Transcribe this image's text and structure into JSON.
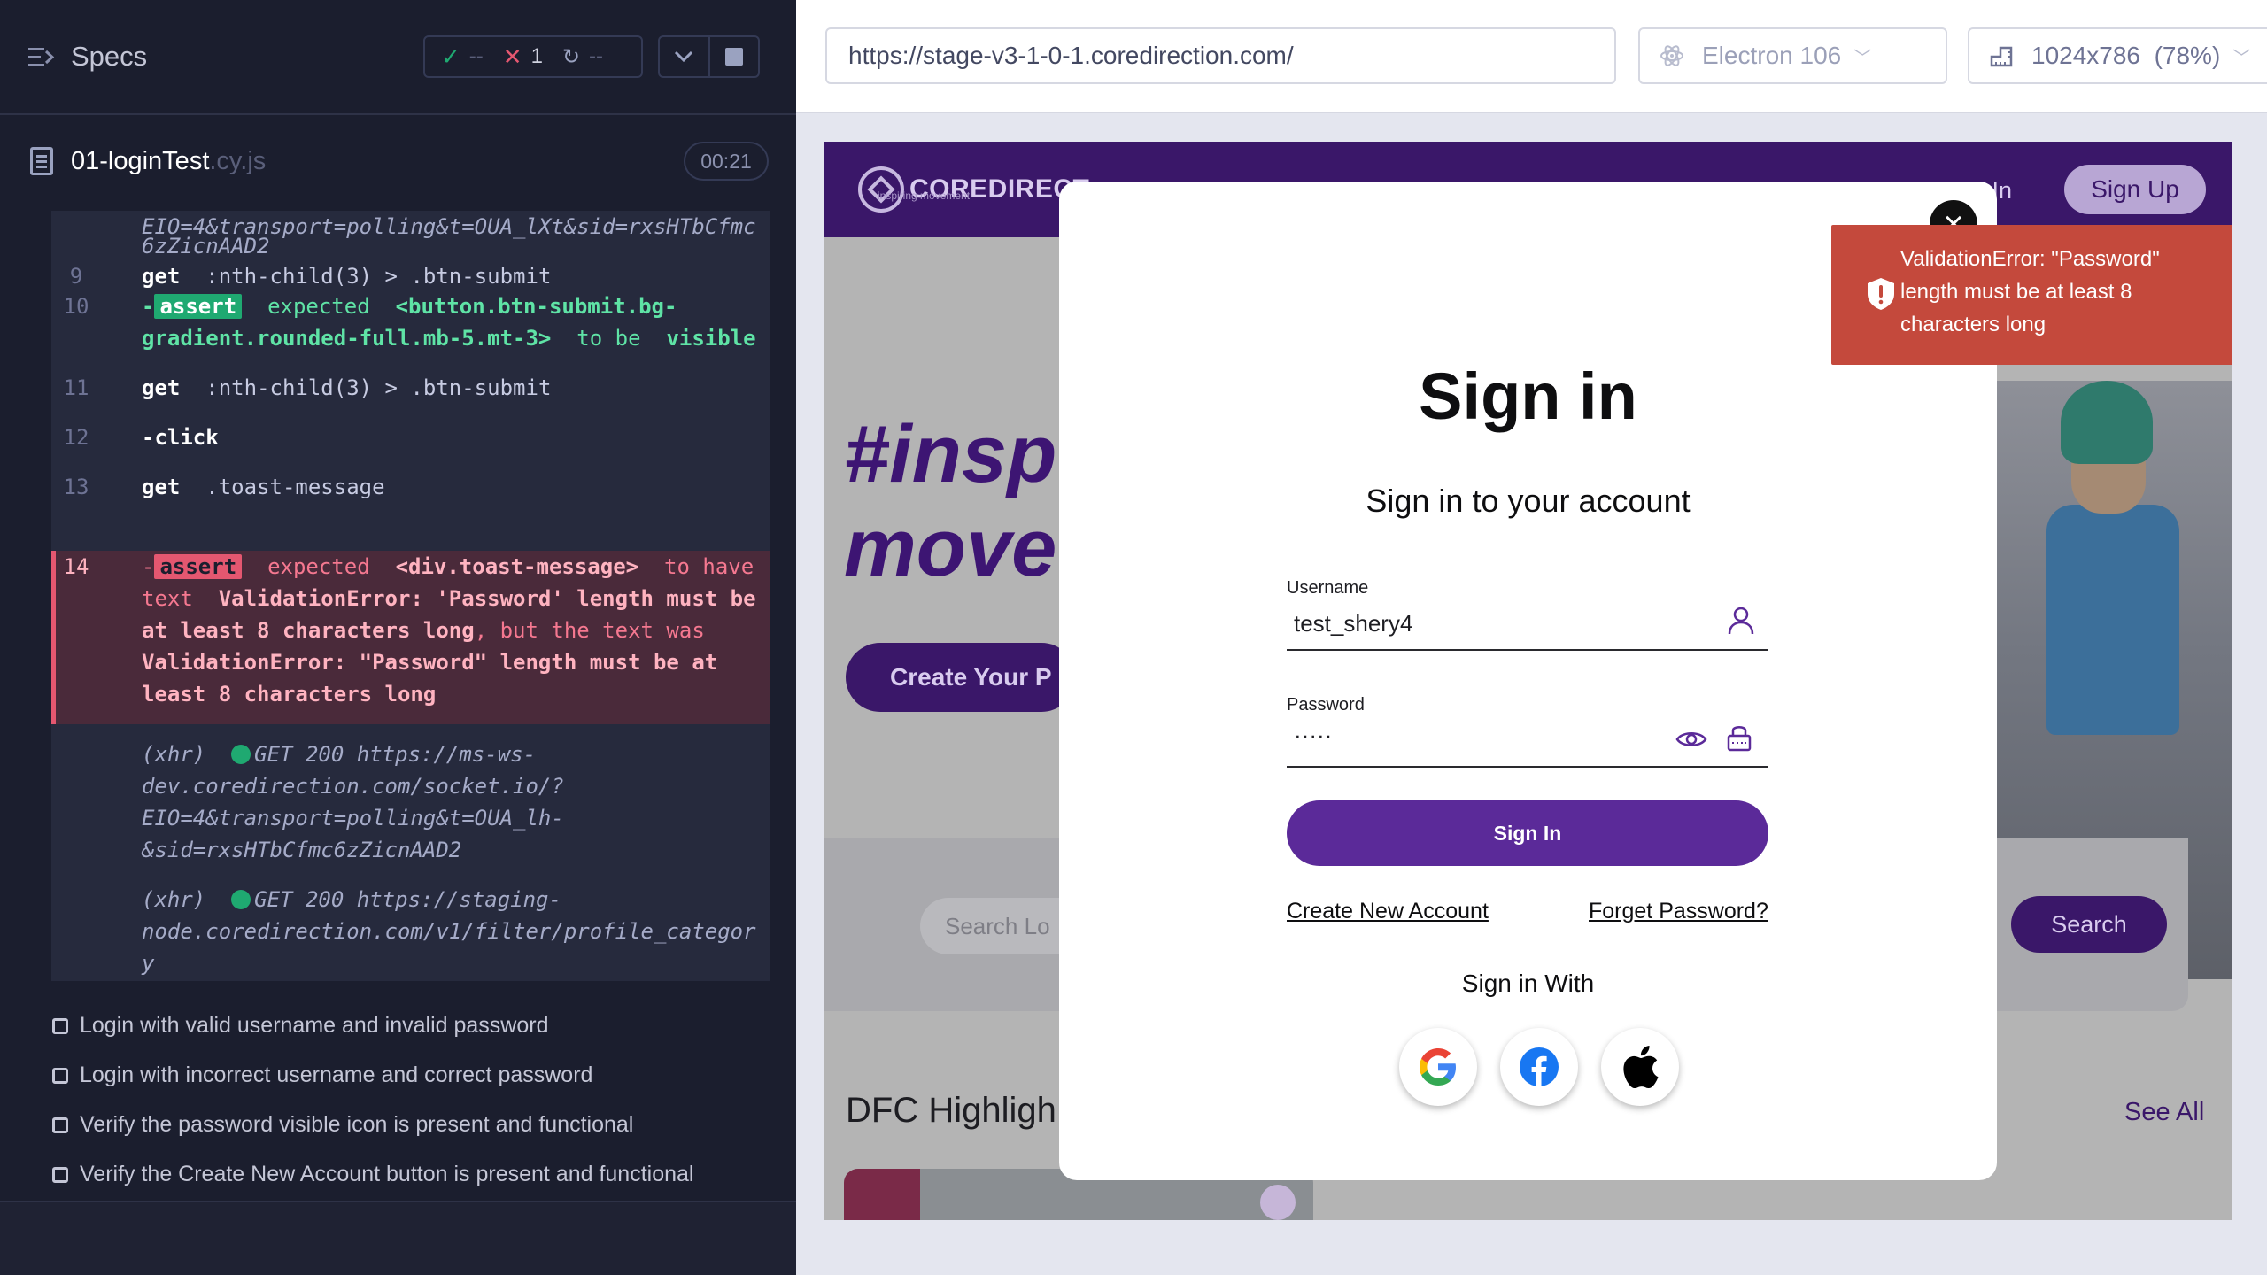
{
  "reporter": {
    "title": "Specs",
    "stats": {
      "passed": "--",
      "failed": "1",
      "pending": "--"
    },
    "file": {
      "name": "01-loginTest",
      "ext": ".cy.js",
      "duration": "00:21"
    },
    "log": {
      "partial_top": [
        "EIO=4&transport=polling&t=OUA_lXt&sid=rxsHTbCfmc",
        "6zZicnAAD2"
      ],
      "lines": [
        {
          "num": "9",
          "cmd": "get",
          "sel": ":nth-child(3) > .btn-submit"
        },
        {
          "num": "10",
          "cmd": "-",
          "badge": "assert",
          "expected": "expected",
          "subject1": "<button.btn-submit.bg-",
          "subject2": "gradient.rounded-full.mb-5.mt-3>",
          "tobe": "to be",
          "state": "visible"
        },
        {
          "num": "11",
          "cmd": "get",
          "sel": ":nth-child(3) > .btn-submit"
        },
        {
          "num": "12",
          "cmd": "-click"
        },
        {
          "num": "13",
          "cmd": "get",
          "sel": ".toast-message"
        }
      ],
      "error": {
        "num": "14",
        "badge": "assert",
        "l1_a": "expected",
        "l1_b": "<div.toast-message>",
        "l1_c": "to have",
        "l2_a": "text",
        "l2_b": "ValidationError: 'Password' length must be",
        "l3_a": "at least 8 characters long",
        "l3_b": ", but the text was",
        "l4": " ValidationError: \"Password\" length must be at",
        "l5": "least 8 characters long"
      },
      "xhr1": {
        "prefix": "(xhr)",
        "method": "GET 200",
        "url1": "https://ms-ws-",
        "url2": "dev.coredirection.com/socket.io/?",
        "url3": "EIO=4&transport=polling&t=OUA_lh-",
        "url4": "&sid=rxsHTbCfmc6zZicnAAD2"
      },
      "xhr2": {
        "prefix": "(xhr)",
        "method": "GET 200",
        "url1": "https://staging-",
        "url2": "node.coredirection.com/v1/filter/profile_categor",
        "url3": "y"
      }
    },
    "tests": [
      "Login with valid username and invalid password",
      "Login with incorrect username and correct password",
      "Verify the password visible icon is present and functional",
      "Verify the Create New Account button is present and functional"
    ]
  },
  "aut": {
    "url": "https://stage-v3-1-0-1.coredirection.com/",
    "browser": "Electron 106",
    "viewport": "1024x786",
    "scale": "(78%)"
  },
  "site": {
    "logo": "COREDIRECT",
    "logo_tagline": "inspiring movement",
    "nav_signin": "n In",
    "nav_signup": "Sign Up",
    "hero_line1": "#insp",
    "hero_line2": "move",
    "hero_button": "Create Your P",
    "search_placeholder": "Search Lo",
    "search_button": "Search",
    "section_title": "DFC Highligh",
    "see_all": "See All"
  },
  "modal": {
    "title": "Sign in",
    "subtitle": "Sign in to your account",
    "username_label": "Username",
    "username_value": "test_shery4",
    "password_label": "Password",
    "password_value": "·····",
    "submit": "Sign In",
    "create_account": "Create New Account",
    "forgot_password": "Forget Password?",
    "sign_in_with": "Sign in With",
    "social": [
      "google-icon",
      "facebook-icon",
      "apple-icon"
    ]
  },
  "toast": {
    "line1": "ValidationError: \"Password\"",
    "line2": "length must be at least 8",
    "line3": "characters long"
  },
  "colors": {
    "reporter_bg": "#1b1e2e",
    "pass": "#1fa971",
    "fail": "#e45770",
    "brand_purple": "#5b2a99",
    "toast_red": "#c4493c"
  }
}
